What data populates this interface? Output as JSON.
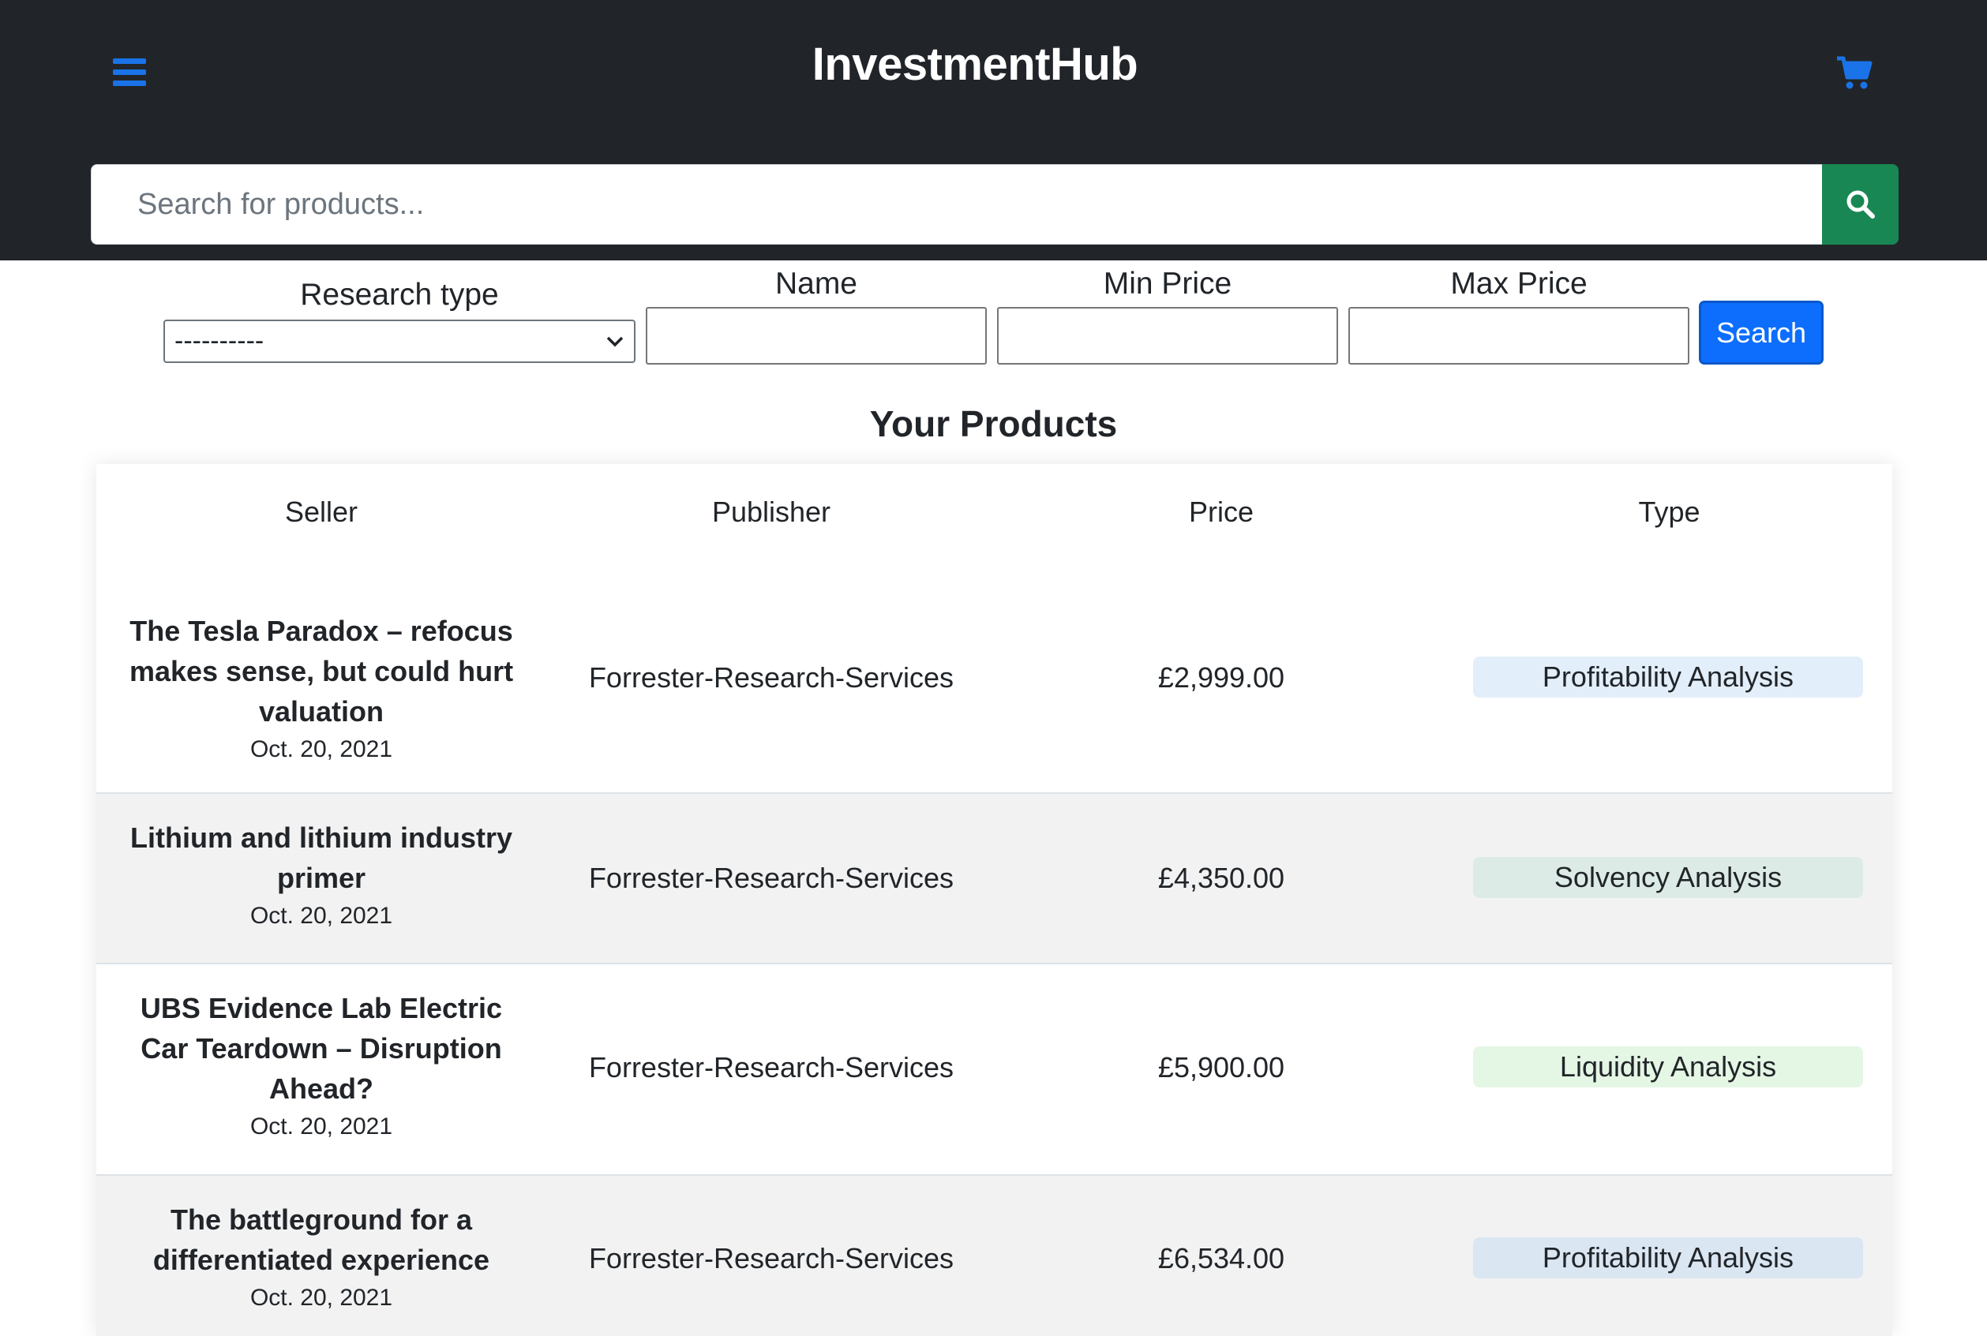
{
  "header": {
    "brand": "InvestmentHub",
    "menu_icon": "hamburger-menu-icon",
    "cart_icon": "shopping-cart-icon",
    "accent_color": "#1a73e8"
  },
  "search": {
    "placeholder": "Search for products...",
    "value": "",
    "button_icon": "search-icon",
    "button_color": "#198754"
  },
  "filters": {
    "research_type_label": "Research type",
    "research_type_value": "----------",
    "name_label": "Name",
    "min_price_label": "Min Price",
    "max_price_label": "Max Price",
    "search_button": "Search"
  },
  "products": {
    "title": "Your Products",
    "columns": [
      "Seller",
      "Publisher",
      "Price",
      "Type"
    ],
    "rows": [
      {
        "title": "The Tesla Paradox – refocus makes sense, but could hurt valuation",
        "date": "Oct. 20, 2021",
        "publisher": "Forrester-Research-Services",
        "price": "£2,999.00",
        "type": "Profitability Analysis",
        "badge_color": "#e2eef9"
      },
      {
        "title": "Lithium and lithium industry primer",
        "date": "Oct. 20, 2021",
        "publisher": "Forrester-Research-Services",
        "price": "£4,350.00",
        "type": "Solvency Analysis",
        "badge_color": "#dcebe5"
      },
      {
        "title": "UBS Evidence Lab Electric Car Teardown – Disruption Ahead?",
        "date": "Oct. 20, 2021",
        "publisher": "Forrester-Research-Services",
        "price": "£5,900.00",
        "type": "Liquidity Analysis",
        "badge_color": "#e4f6e4"
      },
      {
        "title": "The battleground for a differentiated experience",
        "date": "Oct. 20, 2021",
        "publisher": "Forrester-Research-Services",
        "price": "£6,534.00",
        "type": "Profitability Analysis",
        "badge_color": "#dae6f2"
      }
    ]
  }
}
